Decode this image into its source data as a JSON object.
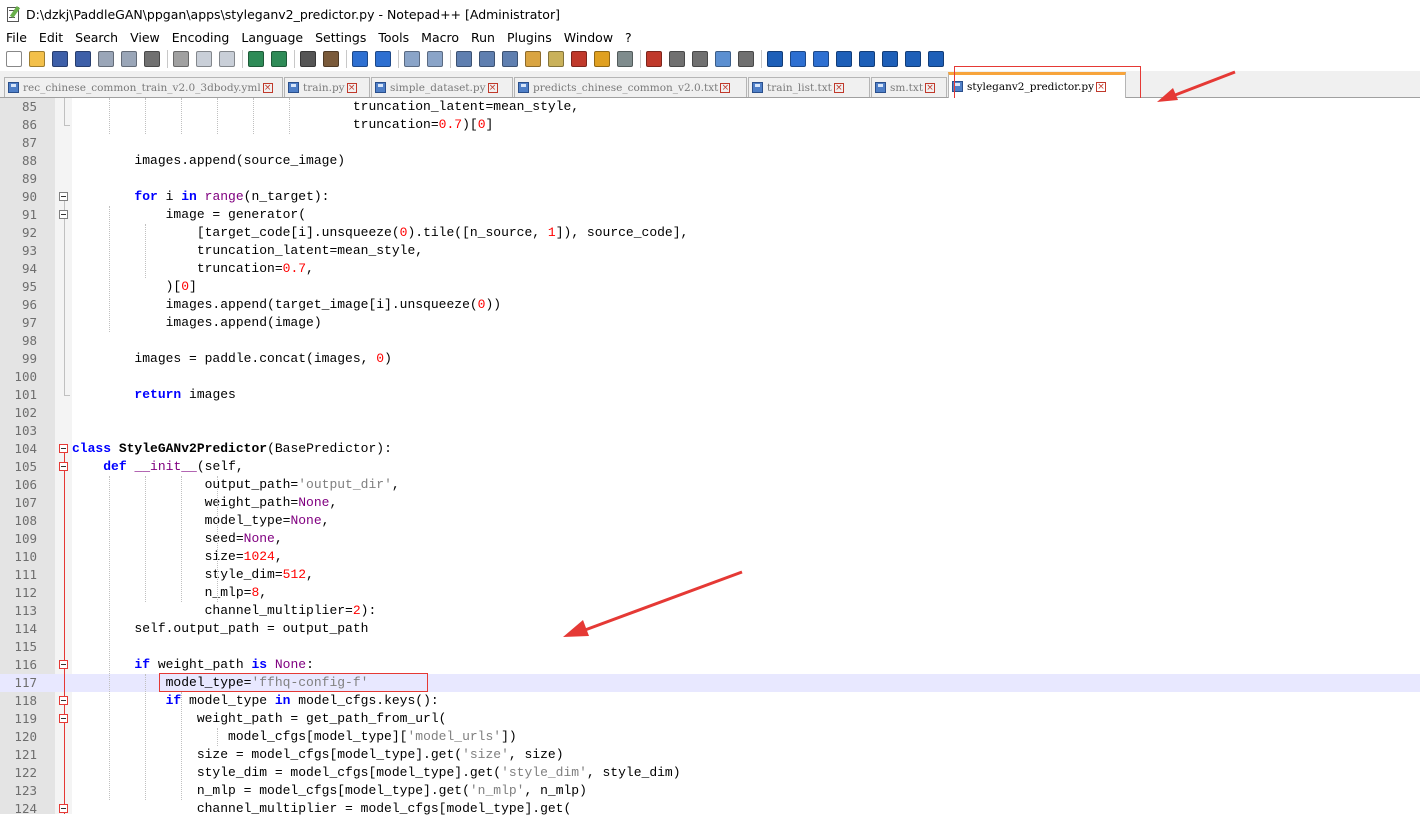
{
  "window": {
    "title": "D:\\dzkj\\PaddleGAN\\ppgan\\apps\\styleganv2_predictor.py - Notepad++ [Administrator]"
  },
  "menu": [
    "File",
    "Edit",
    "Search",
    "View",
    "Encoding",
    "Language",
    "Settings",
    "Tools",
    "Macro",
    "Run",
    "Plugins",
    "Window",
    "?"
  ],
  "toolbar": {
    "buttons": [
      "new",
      "open",
      "save",
      "save-all",
      "close",
      "close-all",
      "print",
      "cut",
      "copy",
      "paste",
      "undo",
      "redo",
      "find",
      "replace",
      "zoom-in",
      "zoom-out",
      "sync-vertical",
      "sync-horizontal",
      "word-wrap",
      "show-all-chars",
      "indent-guide",
      "user-defined-language",
      "document-map",
      "function-list",
      "folder-as-workspace",
      "monitoring",
      "record-macro",
      "stop-recording",
      "play-macro",
      "run-macro-multiple",
      "save-macro",
      "insert",
      "fold",
      "unfold",
      "move-up",
      "up",
      "down",
      "move-down",
      "panel"
    ]
  },
  "tabs": [
    {
      "label": "rec_chinese_common_train_v2.0_3dbody.yml",
      "active": false
    },
    {
      "label": "train.py",
      "active": false
    },
    {
      "label": "simple_dataset.py",
      "active": false
    },
    {
      "label": "predicts_chinese_common_v2.0.txt",
      "active": false
    },
    {
      "label": "train_list.txt",
      "active": false
    },
    {
      "label": "sm.txt",
      "active": false
    },
    {
      "label": "styleganv2_predictor.py",
      "active": true
    }
  ],
  "editor": {
    "current_line": 117,
    "lines": [
      {
        "n": 85,
        "fold": "",
        "code": "                                    truncation_latent=mean_style,"
      },
      {
        "n": 86,
        "fold": "end",
        "code": "                                    truncation=0.7)[0]"
      },
      {
        "n": 87,
        "fold": "",
        "code": ""
      },
      {
        "n": 88,
        "fold": "",
        "code": "        images.append(source_image)"
      },
      {
        "n": 89,
        "fold": "",
        "code": ""
      },
      {
        "n": 90,
        "fold": "box",
        "code": "        for i in range(n_target):"
      },
      {
        "n": 91,
        "fold": "box",
        "code": "            image = generator("
      },
      {
        "n": 92,
        "fold": "",
        "code": "                [target_code[i].unsqueeze(0).tile([n_source, 1]), source_code],"
      },
      {
        "n": 93,
        "fold": "",
        "code": "                truncation_latent=mean_style,"
      },
      {
        "n": 94,
        "fold": "",
        "code": "                truncation=0.7,"
      },
      {
        "n": 95,
        "fold": "",
        "code": "            )[0]"
      },
      {
        "n": 96,
        "fold": "",
        "code": "            images.append(target_image[i].unsqueeze(0))"
      },
      {
        "n": 97,
        "fold": "",
        "code": "            images.append(image)"
      },
      {
        "n": 98,
        "fold": "",
        "code": ""
      },
      {
        "n": 99,
        "fold": "",
        "code": "        images = paddle.concat(images, 0)"
      },
      {
        "n": 100,
        "fold": "",
        "code": ""
      },
      {
        "n": 101,
        "fold": "end",
        "code": "        return images"
      },
      {
        "n": 102,
        "fold": "",
        "code": ""
      },
      {
        "n": 103,
        "fold": "",
        "code": ""
      },
      {
        "n": 104,
        "fold": "box",
        "code": "class StyleGANv2Predictor(BasePredictor):"
      },
      {
        "n": 105,
        "fold": "box",
        "code": "    def __init__(self,"
      },
      {
        "n": 106,
        "fold": "",
        "code": "                 output_path='output_dir',"
      },
      {
        "n": 107,
        "fold": "",
        "code": "                 weight_path=None,"
      },
      {
        "n": 108,
        "fold": "",
        "code": "                 model_type=None,"
      },
      {
        "n": 109,
        "fold": "",
        "code": "                 seed=None,"
      },
      {
        "n": 110,
        "fold": "",
        "code": "                 size=1024,"
      },
      {
        "n": 111,
        "fold": "",
        "code": "                 style_dim=512,"
      },
      {
        "n": 112,
        "fold": "",
        "code": "                 n_mlp=8,"
      },
      {
        "n": 113,
        "fold": "",
        "code": "                 channel_multiplier=2):"
      },
      {
        "n": 114,
        "fold": "",
        "code": "        self.output_path = output_path"
      },
      {
        "n": 115,
        "fold": "",
        "code": ""
      },
      {
        "n": 116,
        "fold": "box",
        "code": "        if weight_path is None:"
      },
      {
        "n": 117,
        "fold": "",
        "code": "            model_type='ffhq-config-f'"
      },
      {
        "n": 118,
        "fold": "box",
        "code": "            if model_type in model_cfgs.keys():"
      },
      {
        "n": 119,
        "fold": "box",
        "code": "                weight_path = get_path_from_url("
      },
      {
        "n": 120,
        "fold": "",
        "code": "                    model_cfgs[model_type]['model_urls'])"
      },
      {
        "n": 121,
        "fold": "",
        "code": "                size = model_cfgs[model_type].get('size', size)"
      },
      {
        "n": 122,
        "fold": "",
        "code": "                style_dim = model_cfgs[model_type].get('style_dim', style_dim)"
      },
      {
        "n": 123,
        "fold": "",
        "code": "                n_mlp = model_cfgs[model_type].get('n_mlp', n_mlp)"
      },
      {
        "n": 124,
        "fold": "box",
        "code": "                channel_multiplier = model_cfgs[model_type].get("
      }
    ]
  },
  "colors": {
    "keyword": "#0000ff",
    "keyword2": "#800080",
    "number": "#ff0000",
    "string": "#808080",
    "annotation": "#e53935",
    "current_line_bg": "#e8e8ff",
    "active_tab_accent": "#f7a43c"
  }
}
